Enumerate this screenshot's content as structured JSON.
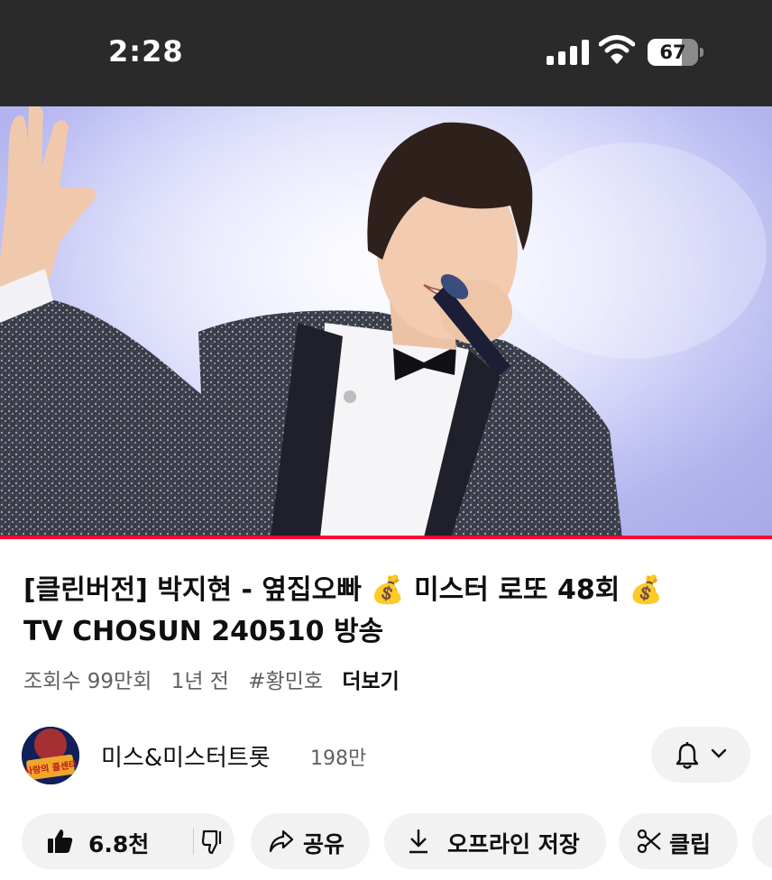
{
  "status_bar": {
    "time": "2:28",
    "battery_percent": "67",
    "battery_level": 0.67,
    "signal_icon": "cellular-signal-icon",
    "wifi_icon": "wifi-icon"
  },
  "video": {
    "progress": 1.0,
    "progress_color": "#ff0033"
  },
  "title": {
    "part1": "[클린버전] 박지현 - 옆집오빠 ",
    "emoji1": "💰",
    "part2": "미스터 로또 48회",
    "emoji2": "💰",
    "part3": "TV CHOSUN 240510 방송"
  },
  "meta": {
    "views": "조회수 99만회",
    "age": "1년 전",
    "hashtag": "#황민호",
    "more": "더보기"
  },
  "channel": {
    "name": "미스&미스터트롯",
    "subscribers": "198만",
    "avatar_text": "사랑의 콜센타"
  },
  "actions": {
    "likes": "6.8천",
    "share": "공유",
    "download": "오프라인 저장",
    "clip": "클립"
  },
  "colors": {
    "status_bar_bg": "#2a2a2a",
    "pill_bg": "#f2f2f2",
    "accent": "#ff0033"
  }
}
